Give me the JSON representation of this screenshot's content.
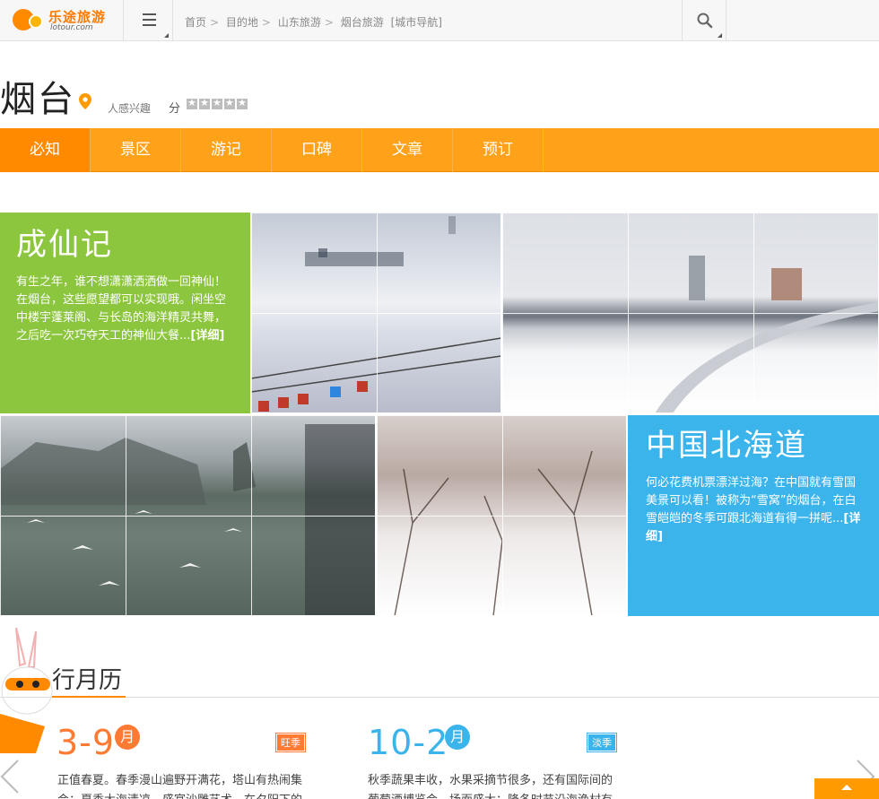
{
  "header": {
    "logo_name": "乐途旅游",
    "logo_domain": "lotour.com",
    "breadcrumb": [
      "首页",
      "目的地",
      "山东旅游",
      "烟台旅游",
      "[城市导航]"
    ],
    "breadcrumb_sep": ">"
  },
  "city": {
    "name": "烟台",
    "interest_label": "人感兴趣",
    "score_label": "分",
    "stars": 5
  },
  "tabs": [
    {
      "label": "必知",
      "active": true
    },
    {
      "label": "景区"
    },
    {
      "label": "游记"
    },
    {
      "label": "口碑"
    },
    {
      "label": "文章"
    },
    {
      "label": "预订"
    }
  ],
  "features": [
    {
      "title": "成仙记",
      "text": "有生之年，谁不想潇潇洒洒做一回神仙！在烟台，这些愿望都可以实现哦。闲坐空中楼宇蓬莱阁、与长岛的海洋精灵共舞，之后吃一次巧夺天工的神仙大餐...",
      "more": "[详细]",
      "color": "#8cc63e"
    },
    {
      "title": "中国北海道",
      "text": "何必花费机票漂洋过海？在中国就有雪国美景可以看！被称为“雪窝”的烟台，在白雪皑皑的冬季可跟北海道有得一拼呢...",
      "more": "[详细]",
      "color": "#3bb4ec"
    }
  ],
  "calendar": {
    "title": "行月历",
    "accent": "#ff8a00",
    "seasons": [
      {
        "range": "3-9",
        "month_char": "月",
        "badge": "旺季",
        "color": "#ff7b34",
        "text": "正值春夏。春季漫山遍野开满花，塔山有热闹集会；夏季大海清凉，盛宴沙雕艺术，在夕阳下的沙滩漫"
      },
      {
        "range": "10-2",
        "month_char": "月",
        "badge": "淡季",
        "color": "#3bb4ec",
        "text": "秋季蔬果丰收，水果采摘节很多，还有国际间的葡萄酒博览会，场面盛大；隆冬时节沿海渔村有传统渔灯"
      }
    ]
  }
}
